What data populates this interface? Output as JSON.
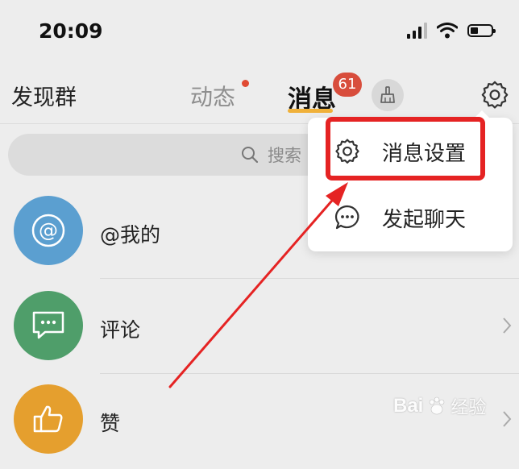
{
  "status_bar": {
    "time": "20:09"
  },
  "nav": {
    "discover_label": "发现群",
    "dynamic_label": "动态",
    "messages_label": "消息",
    "unread_badge": "61"
  },
  "search": {
    "placeholder": "搜索"
  },
  "list": [
    {
      "label": "@我的",
      "icon": "at-icon",
      "color": "#5b9fd0"
    },
    {
      "label": "评论",
      "icon": "comment-icon",
      "color": "#4f9e6a"
    },
    {
      "label": "赞",
      "icon": "thumbs-up-icon",
      "color": "#e59f2e"
    }
  ],
  "menu": {
    "items": [
      {
        "label": "消息设置",
        "icon": "gear-icon"
      },
      {
        "label": "发起聊天",
        "icon": "chat-bubble-icon"
      }
    ]
  },
  "annotation": {
    "highlight_color": "#e52323"
  },
  "watermark": {
    "text": "Bai",
    "suffix": "经验"
  },
  "colors": {
    "accent": "#f0b13a",
    "badge": "#d84d3c"
  }
}
